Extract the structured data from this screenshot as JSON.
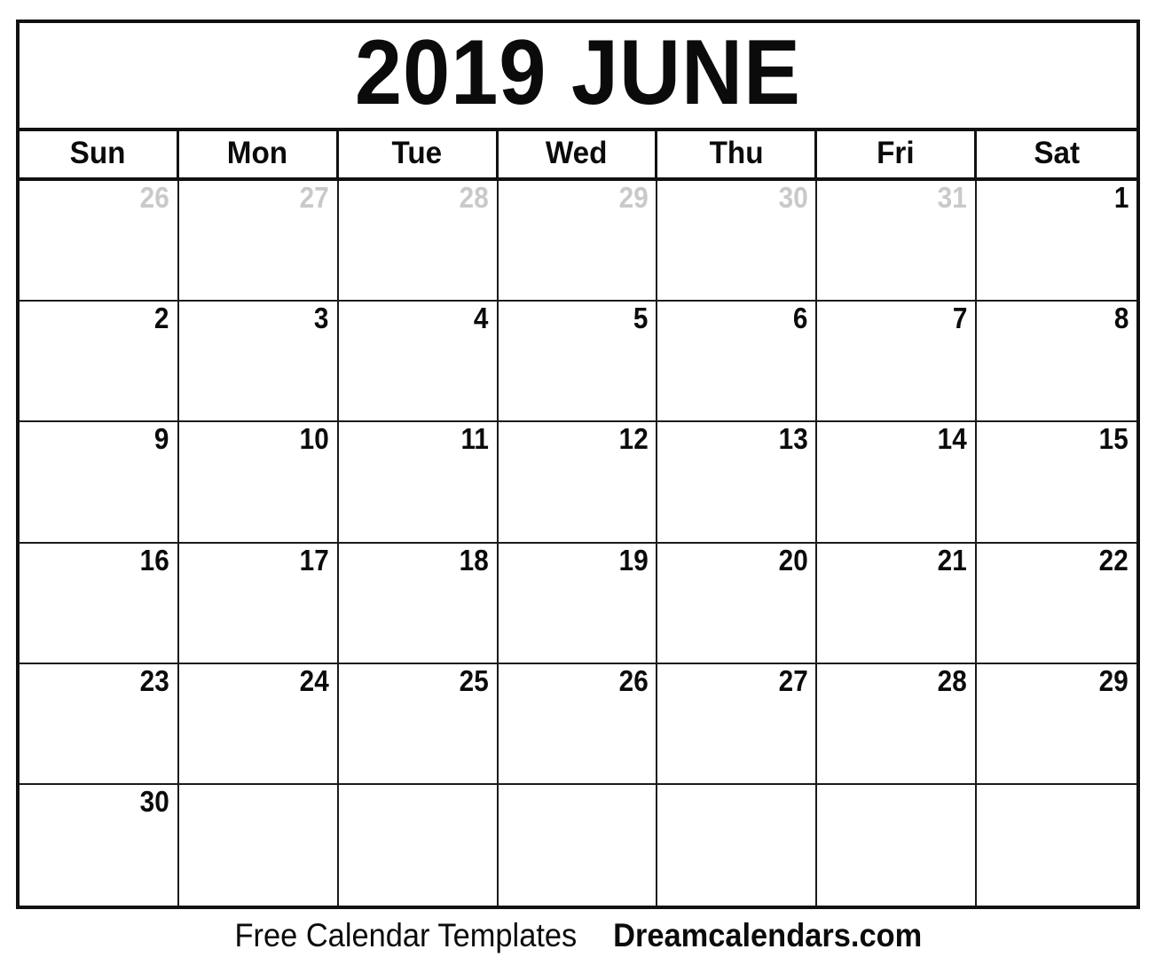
{
  "calendar": {
    "title": "2019 JUNE",
    "year": "2019",
    "month": "JUNE",
    "weekday_headers": [
      "Sun",
      "Mon",
      "Tue",
      "Wed",
      "Thu",
      "Fri",
      "Sat"
    ],
    "colors": {
      "border": "#111111",
      "grid_line": "#1a1a1a",
      "day_text": "#0b0b0b",
      "adjacent_day_text": "#c9c9c9",
      "background": "#ffffff"
    },
    "weeks": [
      [
        {
          "label": "26",
          "adjacent": true
        },
        {
          "label": "27",
          "adjacent": true
        },
        {
          "label": "28",
          "adjacent": true
        },
        {
          "label": "29",
          "adjacent": true
        },
        {
          "label": "30",
          "adjacent": true
        },
        {
          "label": "31",
          "adjacent": true
        },
        {
          "label": "1",
          "adjacent": false
        }
      ],
      [
        {
          "label": "2",
          "adjacent": false
        },
        {
          "label": "3",
          "adjacent": false
        },
        {
          "label": "4",
          "adjacent": false
        },
        {
          "label": "5",
          "adjacent": false
        },
        {
          "label": "6",
          "adjacent": false
        },
        {
          "label": "7",
          "adjacent": false
        },
        {
          "label": "8",
          "adjacent": false
        }
      ],
      [
        {
          "label": "9",
          "adjacent": false
        },
        {
          "label": "10",
          "adjacent": false
        },
        {
          "label": "11",
          "adjacent": false
        },
        {
          "label": "12",
          "adjacent": false
        },
        {
          "label": "13",
          "adjacent": false
        },
        {
          "label": "14",
          "adjacent": false
        },
        {
          "label": "15",
          "adjacent": false
        }
      ],
      [
        {
          "label": "16",
          "adjacent": false
        },
        {
          "label": "17",
          "adjacent": false
        },
        {
          "label": "18",
          "adjacent": false
        },
        {
          "label": "19",
          "adjacent": false
        },
        {
          "label": "20",
          "adjacent": false
        },
        {
          "label": "21",
          "adjacent": false
        },
        {
          "label": "22",
          "adjacent": false
        }
      ],
      [
        {
          "label": "23",
          "adjacent": false
        },
        {
          "label": "24",
          "adjacent": false
        },
        {
          "label": "25",
          "adjacent": false
        },
        {
          "label": "26",
          "adjacent": false
        },
        {
          "label": "27",
          "adjacent": false
        },
        {
          "label": "28",
          "adjacent": false
        },
        {
          "label": "29",
          "adjacent": false
        }
      ],
      [
        {
          "label": "30",
          "adjacent": false
        },
        {
          "label": "",
          "adjacent": false
        },
        {
          "label": "",
          "adjacent": false
        },
        {
          "label": "",
          "adjacent": false
        },
        {
          "label": "",
          "adjacent": false
        },
        {
          "label": "",
          "adjacent": false
        },
        {
          "label": "",
          "adjacent": false
        }
      ]
    ]
  },
  "footer": {
    "free_text": "Free Calendar Templates",
    "site_text": "Dreamcalendars.com"
  }
}
